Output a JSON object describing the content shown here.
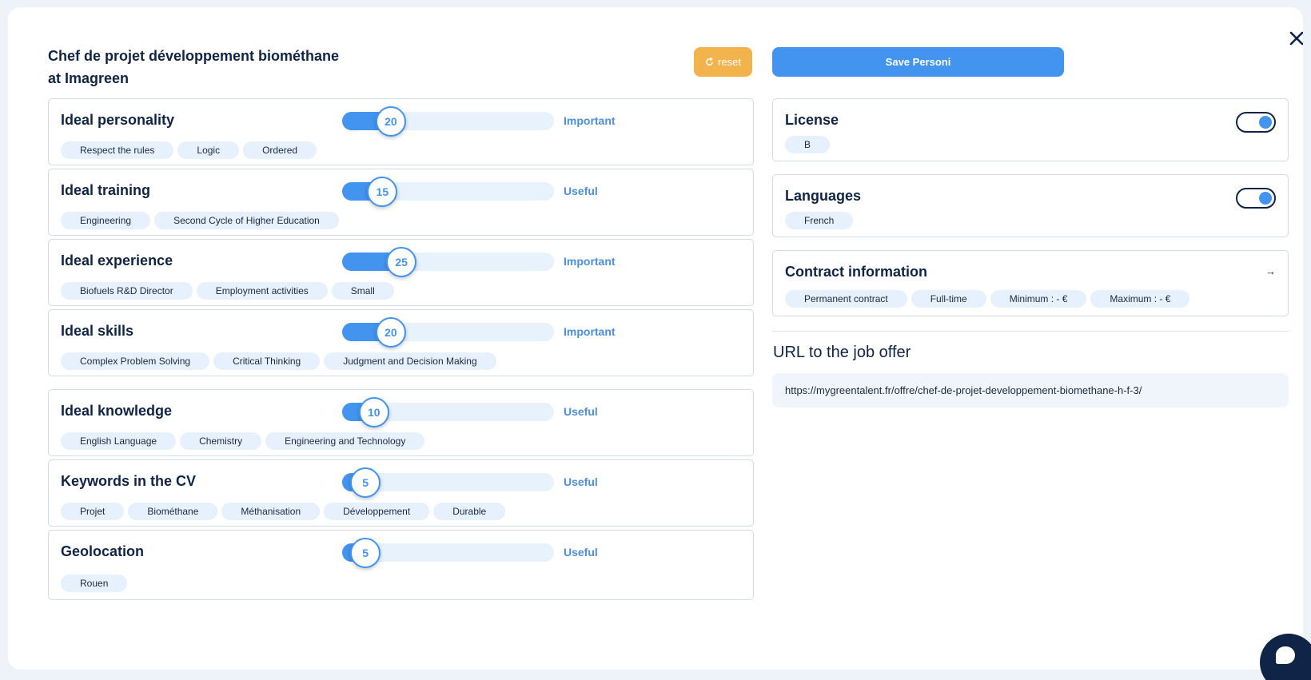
{
  "header": {
    "job_title_line1": "Chef de projet développement biométhane",
    "job_title_line2": "at Imagreen",
    "reset_label": "reset",
    "save_label": "Save Personi"
  },
  "criteria": [
    {
      "title": "Ideal personality",
      "value": "20",
      "level": "Important",
      "fill_pct": 23,
      "tags": [
        "Respect the rules",
        "Logic",
        "Ordered"
      ]
    },
    {
      "title": "Ideal training",
      "value": "15",
      "level": "Useful",
      "fill_pct": 19,
      "tags": [
        "Engineering",
        "Second Cycle of Higher Education"
      ]
    },
    {
      "title": "Ideal experience",
      "value": "25",
      "level": "Important",
      "fill_pct": 28,
      "tags": [
        "Biofuels R&D Director",
        "Employment activities",
        "Small"
      ]
    },
    {
      "title": "Ideal skills",
      "value": "20",
      "level": "Important",
      "fill_pct": 23,
      "tags": [
        "Complex Problem Solving",
        "Critical Thinking",
        "Judgment and Decision Making"
      ]
    },
    {
      "title": "Ideal knowledge",
      "value": "10",
      "level": "Useful",
      "fill_pct": 15,
      "tags": [
        "English Language",
        "Chemistry",
        "Engineering and Technology"
      ]
    },
    {
      "title": "Keywords in the CV",
      "value": "5",
      "level": "Useful",
      "fill_pct": 11,
      "tags": [
        "Projet",
        "Biométhane",
        "Méthanisation",
        "Développement",
        "Durable"
      ]
    },
    {
      "title": "Geolocation",
      "value": "5",
      "level": "Useful",
      "fill_pct": 11,
      "tags": [
        "Rouen"
      ]
    }
  ],
  "license": {
    "title": "License",
    "enabled": true,
    "tags": [
      "B"
    ]
  },
  "languages": {
    "title": "Languages",
    "enabled": true,
    "tags": [
      "French"
    ]
  },
  "contract": {
    "title": "Contract information",
    "tags": [
      "Permanent contract",
      "Full-time",
      "Minimum : - €",
      "Maximum : - €"
    ]
  },
  "url_section": {
    "heading": "URL to the job offer",
    "url": "https://mygreentalent.fr/offre/chef-de-projet-developpement-biomethane-h-f-3/"
  },
  "colors": {
    "accent": "#4294ef",
    "reset": "#f2b34d",
    "navy": "#0f2446",
    "tag_bg": "#e6f1fd"
  },
  "icons": {
    "close": "close-icon",
    "reset": "refresh-icon",
    "arrow": "arrow-right-icon",
    "chat": "chat-bubble-icon"
  }
}
